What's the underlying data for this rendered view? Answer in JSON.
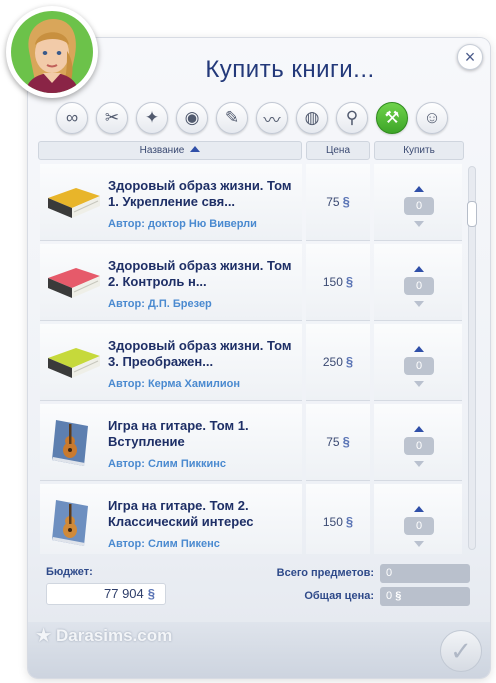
{
  "dialog": {
    "title": "Купить книги...",
    "close_label": "×"
  },
  "categories": [
    {
      "icon": "infinity-icon",
      "glyph": "∞",
      "active": false
    },
    {
      "icon": "toys-icon",
      "glyph": "✂",
      "active": false
    },
    {
      "icon": "magic-wand-icon",
      "glyph": "✦",
      "active": false
    },
    {
      "icon": "glasses-icon",
      "glyph": "◉",
      "active": false
    },
    {
      "icon": "feather-icon",
      "glyph": "✎",
      "active": false
    },
    {
      "icon": "mustache-icon",
      "glyph": "〰",
      "active": false
    },
    {
      "icon": "planet-icon",
      "glyph": "◍",
      "active": false
    },
    {
      "icon": "magnifier-icon",
      "glyph": "⚲",
      "active": false
    },
    {
      "icon": "hammer-icon",
      "glyph": "⚒",
      "active": true
    },
    {
      "icon": "smiley-icon",
      "glyph": "☺",
      "active": false
    }
  ],
  "table": {
    "col_name": "Название",
    "col_price": "Цена",
    "col_buy": "Купить",
    "currency": "§",
    "rows": [
      {
        "title": "Здоровый образ жизни. Том 1. Укрепление свя...",
        "author": "Автор: доктор Ню Виверли",
        "price": "75",
        "qty": "0",
        "cover": "#e8b52a"
      },
      {
        "title": "Здоровый образ жизни. Том 2. Контроль н...",
        "author": "Автор: Д.П. Брезер",
        "price": "150",
        "qty": "0",
        "cover": "#e65a6a"
      },
      {
        "title": "Здоровый образ жизни. Том 3. Преображен...",
        "author": "Автор: Керма Хамилион",
        "price": "250",
        "qty": "0",
        "cover": "#c6d93b"
      },
      {
        "title": "Игра на гитаре. Том 1. Вступление",
        "author": "Автор: Слим Пиккинс",
        "price": "75",
        "qty": "0",
        "cover": "#5d7fb0"
      },
      {
        "title": "Игра на гитаре. Том 2. Классический интерес",
        "author": "Автор: Слим Пикенс",
        "price": "150",
        "qty": "0",
        "cover": "#6d8fc0"
      }
    ]
  },
  "footer": {
    "budget_label": "Бюджет:",
    "budget_value": "77 904",
    "total_items_label": "Всего предметов:",
    "total_items_value": "0",
    "total_price_label": "Общая цена:",
    "total_price_value": "0",
    "watermark": "Darasims.com",
    "confirm_glyph": "✓"
  }
}
